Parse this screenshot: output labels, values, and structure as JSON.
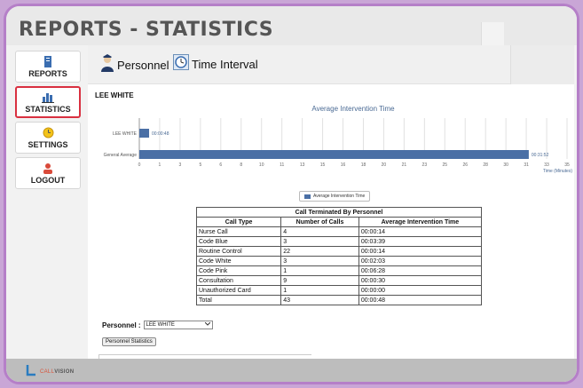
{
  "header": {
    "title": "REPORTS - STATISTICS"
  },
  "sidebar": {
    "items": [
      {
        "label": "REPORTS",
        "icon": "book-icon",
        "active": false
      },
      {
        "label": "STATISTICS",
        "icon": "bar-chart-icon",
        "active": true
      },
      {
        "label": "SETTINGS",
        "icon": "clock-gear-icon",
        "active": false
      },
      {
        "label": "LOGOUT",
        "icon": "person-logout-icon",
        "active": false
      }
    ]
  },
  "tabs": [
    {
      "label": "Personnel",
      "icon": "nurse-icon"
    },
    {
      "label": "Time Interval",
      "icon": "clock-icon"
    }
  ],
  "person_name": "LEE WHITE",
  "chart_data": {
    "type": "bar",
    "orientation": "horizontal",
    "title": "Average Intervention Time",
    "categories": [
      "LEE WHITE",
      "General Average"
    ],
    "series": [
      {
        "name": "Average Intervention Time",
        "values": [
          0.8,
          31.87
        ],
        "labels": [
          "00:00:48",
          "00:31:52"
        ]
      }
    ],
    "xlabel": "Time (Minutes)",
    "xlim": [
      0,
      35
    ],
    "xticks": [
      "0",
      "1",
      "3",
      "5",
      "6",
      "8",
      "10",
      "11",
      "13",
      "15",
      "16",
      "18",
      "20",
      "21",
      "23",
      "25",
      "26",
      "28",
      "30",
      "31",
      "33",
      "35"
    ],
    "grid": true,
    "legend": "bottom-center",
    "color": "#4a6fa5"
  },
  "table": {
    "caption": "Call Terminated By Personnel",
    "headers": [
      "Call Type",
      "Number of Calls",
      "Average Intervention Time"
    ],
    "rows": [
      [
        "Nurse Call",
        "4",
        "00:00:14"
      ],
      [
        "Code Blue",
        "3",
        "00:03:39"
      ],
      [
        "Routine Control",
        "22",
        "00:00:14"
      ],
      [
        "Code White",
        "3",
        "00:02:03"
      ],
      [
        "Code Pink",
        "1",
        "00:06:28"
      ],
      [
        "Consultation",
        "9",
        "00:00:30"
      ],
      [
        "Unauthorized Card",
        "1",
        "00:00:00"
      ],
      [
        "Total",
        "43",
        "00:00:48"
      ]
    ]
  },
  "personnel_select": {
    "label": "Personnel :",
    "value": "LEE WHITE"
  },
  "stats_button": "Personnel Statistics",
  "footer": {
    "logo_a": "CALL",
    "logo_b": "VISION"
  }
}
